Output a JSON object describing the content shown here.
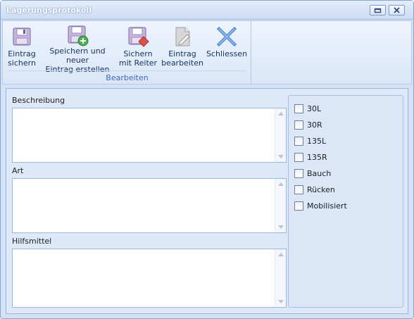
{
  "window": {
    "title": "Lagerungsprotokoll"
  },
  "ribbon": {
    "group_label": "Bearbeiten",
    "buttons": [
      {
        "label": "Eintrag\nsichern",
        "icon": "floppy-disk-icon"
      },
      {
        "label": "Speichern und neuer\nEintrag erstellen",
        "icon": "floppy-add-icon"
      },
      {
        "label": "Sichern\nmit Reiter",
        "icon": "floppy-tab-icon"
      },
      {
        "label": "Eintrag\nbearbeiten",
        "icon": "edit-document-icon"
      },
      {
        "label": "Schliessen",
        "icon": "close-x-icon"
      }
    ]
  },
  "form": {
    "beschreibung_label": "Beschreibung",
    "beschreibung_value": "",
    "art_label": "Art",
    "art_value": "",
    "hilfsmittel_label": "Hilfsmittel",
    "hilfsmittel_value": ""
  },
  "checkboxes": [
    {
      "label": "30L",
      "checked": false
    },
    {
      "label": "30R",
      "checked": false
    },
    {
      "label": "135L",
      "checked": false
    },
    {
      "label": "135R",
      "checked": false
    },
    {
      "label": "Bauch",
      "checked": false
    },
    {
      "label": "Rücken",
      "checked": false
    },
    {
      "label": "Mobilisiert",
      "checked": false
    }
  ],
  "colors": {
    "accent": "#3a6bc1",
    "window_bg": "#d5e2f6",
    "delete_red": "#e0504a",
    "add_green": "#4caf50"
  }
}
